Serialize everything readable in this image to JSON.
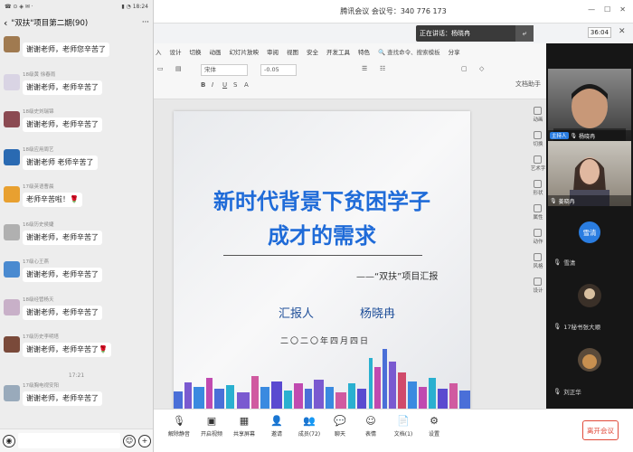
{
  "phone": {
    "status_left": "☎ ⊙ ◈ ✉ ·",
    "status_right": "▮ ◔ 18:24",
    "chat_title": "\"双扶\"项目第二期(90)",
    "more": "···",
    "messages": [
      {
        "sender": "",
        "text": "谢谢老师，老师您辛苦了",
        "color": "#a07a50"
      },
      {
        "sender": "18级黄 徐春雨",
        "text": "谢谢老师，老师辛苦了",
        "color": "#d9d4e4"
      },
      {
        "sender": "18级史刘瑞锦",
        "text": "谢谢老师，老师辛苦了",
        "color": "#8b4a52"
      },
      {
        "sender": "18级应用周艺",
        "text": "谢谢老师 老师辛苦了",
        "color": "#2a6ab2"
      },
      {
        "sender": "17级英语曹晨",
        "text": "老师辛苦啦！🌹",
        "color": "#e8a030"
      },
      {
        "sender": "16级历史侯婕",
        "text": "谢谢老师，老师辛苦了",
        "color": "#b0b0b0"
      },
      {
        "sender": "17级心王燕",
        "text": "谢谢老师，老师辛苦了",
        "color": "#4a8ad0"
      },
      {
        "sender": "18级经管杨天",
        "text": "谢谢老师，老师辛苦了",
        "color": "#c8b0c8"
      },
      {
        "sender": "17级历史李明塔",
        "text": "谢谢老师，老师辛苦了🌹",
        "color": "#7a4a3a"
      }
    ],
    "time_divider": "17:21",
    "last_sender": "17级胸电视安阳",
    "last_text": "谢谢老师，老师辛苦了",
    "voice_icon": "◉",
    "emoji_icon": "☺",
    "plus_icon": "+"
  },
  "meeting": {
    "title": "腾讯会议  会议号：340 776 173",
    "speaking_label": "正在讲话：杨晓冉",
    "timer": "36:04",
    "close": "✕"
  },
  "wps": {
    "menus": [
      "入",
      "设计",
      "切换",
      "动画",
      "幻灯片放映",
      "审阅",
      "视图",
      "安全",
      "开发工具",
      "特色"
    ],
    "search": "🔍 查找命令、搜索模板",
    "share": "分享",
    "font": "宋体",
    "size": "-0.05",
    "doc_assist": "文档助手"
  },
  "slide": {
    "title_line1": "新时代背景下贫困学子",
    "title_line2": "成才的需求",
    "subtitle": "——“双扶”项目汇报",
    "reporter_label": "汇报人",
    "reporter_name": "杨晓冉",
    "date": "二〇二〇年四月四日"
  },
  "right_side": [
    "动画",
    "切换",
    "艺术字",
    "形状",
    "属性",
    "动作",
    "风格",
    "设计"
  ],
  "video": {
    "host_tag": "主持人",
    "host_name": "杨晓冉",
    "tile2_name": "姜晓冉",
    "xue_circle": "雪清",
    "participant1": "雪清",
    "participant2": "17秘书张大顺",
    "participant3": "刘正华"
  },
  "toolbar": {
    "items": [
      "解除静音",
      "开启视频",
      "共享屏幕",
      "邀请",
      "成员(72)",
      "聊天",
      "表情",
      "文档(1)",
      "设置"
    ],
    "leave": "离开会议"
  }
}
